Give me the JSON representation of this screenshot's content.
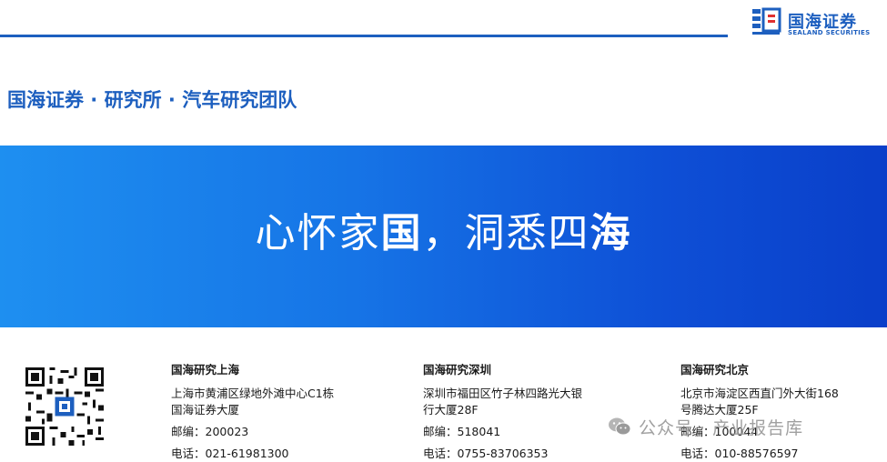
{
  "header": {
    "logo_cn": "国海证券",
    "logo_en": "SEALAND SECURITIES",
    "accent": "#1d5fbf"
  },
  "team_line": "国海证券 · 研究所 · 汽车研究团队",
  "banner": {
    "slogan_part1": "心怀家",
    "slogan_part2": "国",
    "slogan_part3": "，洞悉四",
    "slogan_part4": "海",
    "gradient": [
      "#1e8ff0",
      "#0a3fc9"
    ]
  },
  "offices": [
    {
      "name": "国海研究上海",
      "address": [
        "上海市黄浦区绿地外滩中心C1栋",
        "国海证券大厦"
      ],
      "postcode_label": "邮编：",
      "postcode": "200023",
      "phone_label": "电话：",
      "phone": "021-61981300"
    },
    {
      "name": "国海研究深圳",
      "address": [
        "深圳市福田区竹子林四路光大银",
        "行大厦28F"
      ],
      "postcode_label": "邮编：",
      "postcode": "518041",
      "phone_label": "电话：",
      "phone": "0755-83706353"
    },
    {
      "name": "国海研究北京",
      "address": [
        "北京市海淀区西直门外大街168",
        "号腾达大厦25F"
      ],
      "postcode_label": "邮编：",
      "postcode": "100044",
      "phone_label": "电话：",
      "phone": "010-88576597"
    }
  ],
  "watermark": {
    "text": "公众号 · 产业报告库",
    "icon": "wechat-icon"
  },
  "qr_icon": "qr-code-icon"
}
